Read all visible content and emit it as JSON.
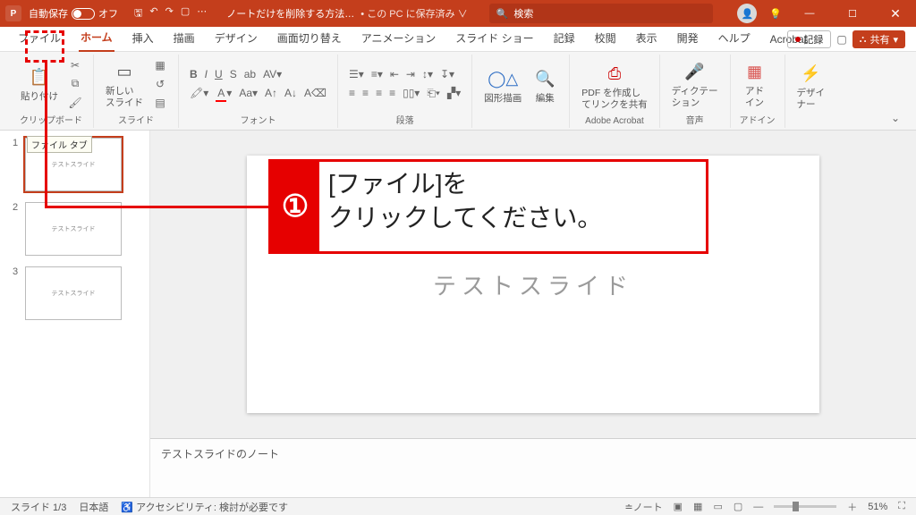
{
  "titlebar": {
    "autosave_label": "自動保存",
    "autosave_state": "オフ",
    "doc_title": "ノートだけを削除する方法…",
    "save_status": "• この PC に保存済み ∨",
    "search_placeholder": "検索"
  },
  "tabs": {
    "items": [
      "ファイル",
      "ホーム",
      "挿入",
      "描画",
      "デザイン",
      "画面切り替え",
      "アニメーション",
      "スライド ショー",
      "記録",
      "校閲",
      "表示",
      "開発",
      "ヘルプ",
      "Acrobat"
    ],
    "active_index": 1,
    "record_label": "記録",
    "share_label": "共有"
  },
  "ribbon": {
    "group_clipboard": "クリップボード",
    "btn_paste": "貼り付け",
    "group_slides": "スライド",
    "btn_newslide": "新しい\nスライド",
    "group_font": "フォント",
    "group_paragraph": "段落",
    "group_drawing_btn": "図形描画",
    "btn_edit": "編集",
    "group_acrobat": "Adobe Acrobat",
    "btn_pdf": "PDF を作成し\nてリンクを共有",
    "group_voice": "音声",
    "btn_dictate": "ディクテー\nション",
    "group_addin": "アドイン",
    "btn_addin": "アド\nイン",
    "btn_designer": "デザイ\nナー"
  },
  "thumbs": {
    "count": 3,
    "selected": 1,
    "placeholder": "テストスライド"
  },
  "slide": {
    "title": "テストスライド"
  },
  "notes": {
    "text": "テストスライドのノート"
  },
  "annotation": {
    "step_num": "①",
    "text_line1": "[ファイル]を",
    "text_line2": "クリックしてください。",
    "tooltip": "ファイル タブ"
  },
  "status": {
    "slide_pos": "スライド 1/3",
    "lang": "日本語",
    "a11y": "アクセシビリティ: 検討が必要です",
    "notes_btn": "ノート",
    "zoom": "51%"
  }
}
